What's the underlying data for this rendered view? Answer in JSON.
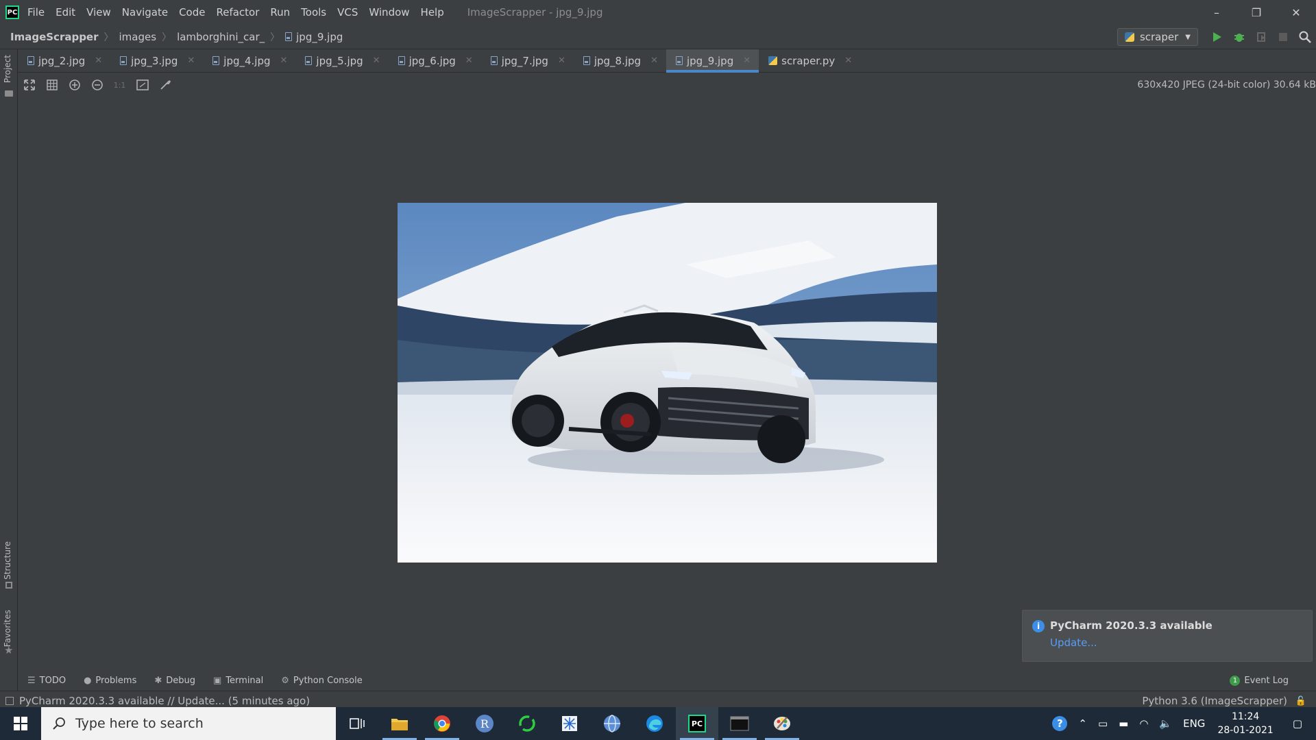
{
  "window": {
    "logo": "PC",
    "menu": [
      "File",
      "Edit",
      "View",
      "Navigate",
      "Code",
      "Refactor",
      "Run",
      "Tools",
      "VCS",
      "Window",
      "Help"
    ],
    "title": "ImageScrapper - jpg_9.jpg",
    "minimize": "–",
    "restore": "❐",
    "close": "✕"
  },
  "breadcrumb": {
    "project": "ImageScrapper",
    "folder1": "images",
    "folder2": "lamborghini_car_",
    "file": "jpg_9.jpg"
  },
  "run_config": {
    "label": "scraper"
  },
  "side_panels": {
    "project": "Project",
    "structure": "Structure",
    "favorites": "Favorites"
  },
  "tabs": [
    {
      "label": "jpg_2.jpg"
    },
    {
      "label": "jpg_3.jpg"
    },
    {
      "label": "jpg_4.jpg"
    },
    {
      "label": "jpg_5.jpg"
    },
    {
      "label": "jpg_6.jpg"
    },
    {
      "label": "jpg_7.jpg"
    },
    {
      "label": "jpg_8.jpg"
    },
    {
      "label": "jpg_9.jpg"
    },
    {
      "label": "scraper.py"
    }
  ],
  "image_toolbar": {
    "actual_size": "1:1"
  },
  "image_info": "630x420 JPEG (24-bit color) 30.64 kB",
  "notification": {
    "title": "PyCharm 2020.3.3 available",
    "link": "Update..."
  },
  "tool_windows": {
    "todo": "TODO",
    "problems": "Problems",
    "debug": "Debug",
    "terminal": "Terminal",
    "python_console": "Python Console",
    "event_log": "Event Log",
    "event_count": "1"
  },
  "status": {
    "message": "PyCharm 2020.3.3 available // Update... (5 minutes ago)",
    "interpreter": "Python 3.6 (ImageScrapper)"
  },
  "taskbar": {
    "search_placeholder": "Type here to search",
    "language": "ENG",
    "time": "11:24",
    "date": "28-01-2021",
    "pycharm_icon": "PC",
    "r_icon": "R"
  },
  "colors": {
    "ide_bg": "#3c3f41",
    "accent": "#4a88c7",
    "link": "#589df6",
    "taskbar": "#1f2a38"
  }
}
